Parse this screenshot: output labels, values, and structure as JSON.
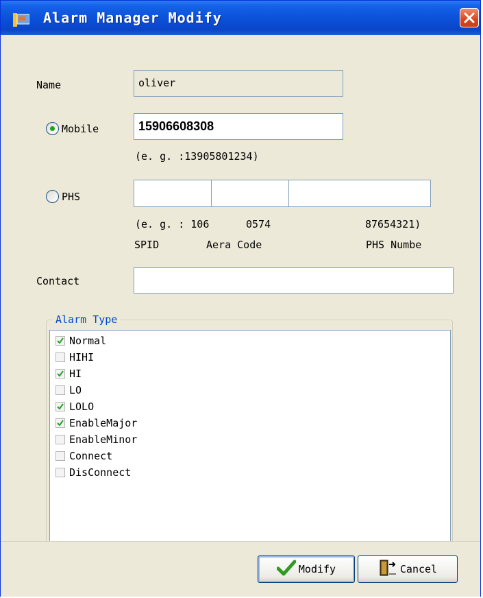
{
  "window": {
    "title": "Alarm Manager Modify"
  },
  "form": {
    "name_label": "Name",
    "name_value": "oliver",
    "mobile_label": "Mobile",
    "mobile_selected": true,
    "mobile_value": "15906608308",
    "mobile_example": "(e. g. :13905801234)",
    "phs_label": "PHS",
    "phs_selected": false,
    "phs_spid_value": "",
    "phs_area_value": "",
    "phs_number_value": "",
    "phs_example_prefix": "(e. g. : 106",
    "phs_example_area": "0574",
    "phs_example_number": "87654321)",
    "phs_spid_caption": "SPID",
    "phs_area_caption": "Aera Code",
    "phs_number_caption": "PHS Numbe",
    "contact_label": "Contact",
    "contact_value": ""
  },
  "alarm_type": {
    "title": "Alarm Type",
    "items": [
      {
        "label": "Normal",
        "checked": true
      },
      {
        "label": "HIHI",
        "checked": false
      },
      {
        "label": "HI",
        "checked": true
      },
      {
        "label": "LO",
        "checked": false
      },
      {
        "label": "LOLO",
        "checked": true
      },
      {
        "label": "EnableMajor",
        "checked": true
      },
      {
        "label": "EnableMinor",
        "checked": false
      },
      {
        "label": "Connect",
        "checked": false
      },
      {
        "label": "DisConnect",
        "checked": false
      }
    ]
  },
  "buttons": {
    "modify_label": "Modify",
    "cancel_label": "Cancel"
  },
  "colors": {
    "titlebar": "#0a4fd8",
    "check": "#21a121",
    "group_title": "#0046d5"
  }
}
